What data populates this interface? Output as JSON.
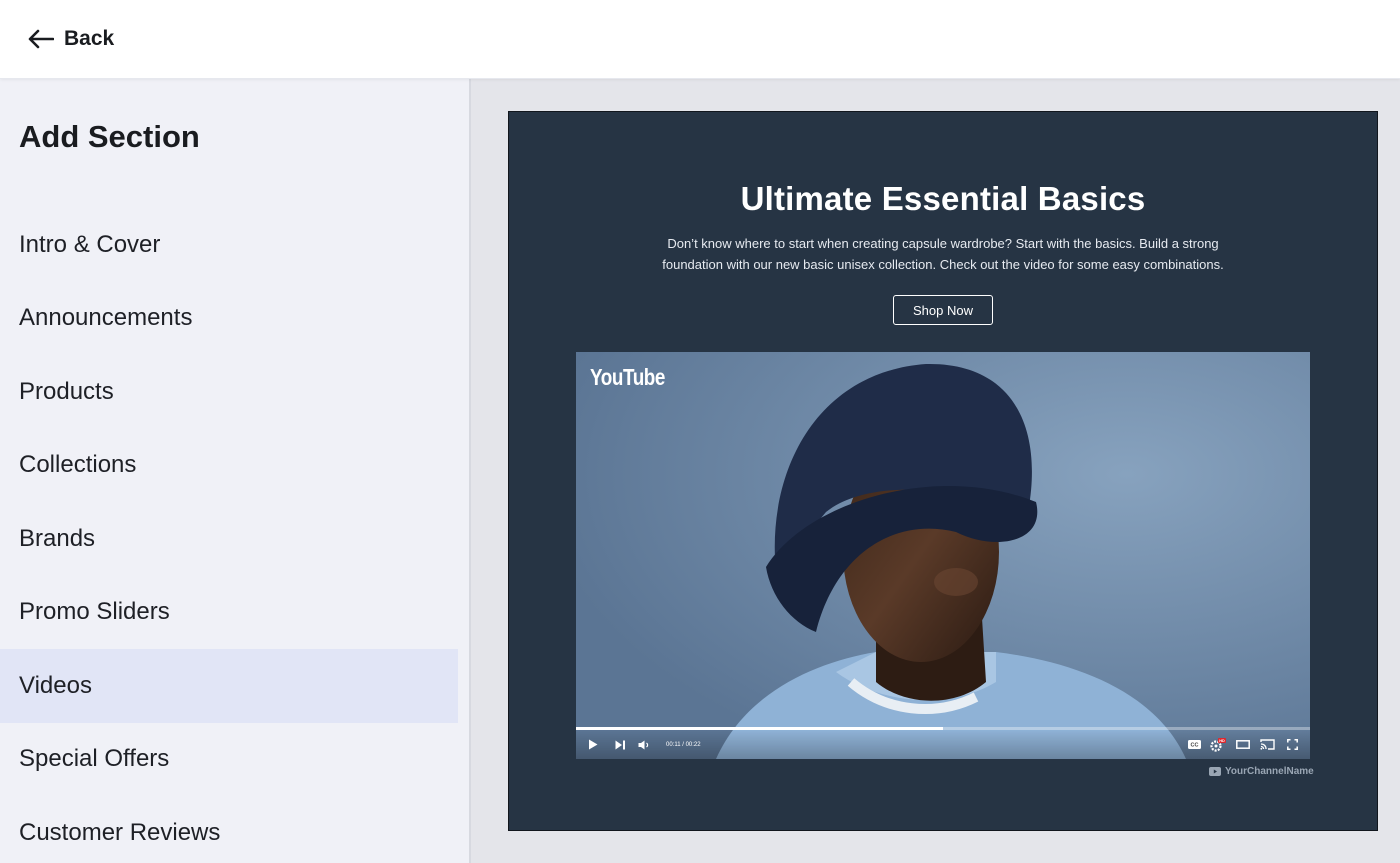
{
  "header": {
    "back_label": "Back",
    "back_icon": "arrow-left-icon"
  },
  "sidebar": {
    "title": "Add Section",
    "items": [
      {
        "label": "Intro & Cover",
        "active": false
      },
      {
        "label": "Announcements",
        "active": false
      },
      {
        "label": "Products",
        "active": false
      },
      {
        "label": "Collections",
        "active": false
      },
      {
        "label": "Brands",
        "active": false
      },
      {
        "label": "Promo Sliders",
        "active": false
      },
      {
        "label": "Videos",
        "active": true
      },
      {
        "label": "Special Offers",
        "active": false
      },
      {
        "label": "Customer Reviews",
        "active": false
      }
    ]
  },
  "preview": {
    "title": "Ultimate Essential Basics",
    "description": "Don’t know where to start when creating capsule wardrobe? Start with the basics. Build a strong foundation with our new basic unisex collection. Check out the video for some easy combinations.",
    "cta_label": "Shop Now",
    "video": {
      "logo_text": "YouTube",
      "time": "00:11 / 00:22",
      "progress": 0.5,
      "channel_name": "YourChannelName",
      "controls": [
        "play-icon",
        "next-icon",
        "volume-icon",
        "captions-icon",
        "settings-icon",
        "theater-icon",
        "cast-icon",
        "fullscreen-icon"
      ]
    }
  },
  "colors": {
    "active_item_bg": "#e1e5f6",
    "sidebar_bg": "#f0f1f7",
    "canvas_bg": "#e4e5ea",
    "preview_bg": "#263444",
    "hd_badge": "#e0262c"
  }
}
